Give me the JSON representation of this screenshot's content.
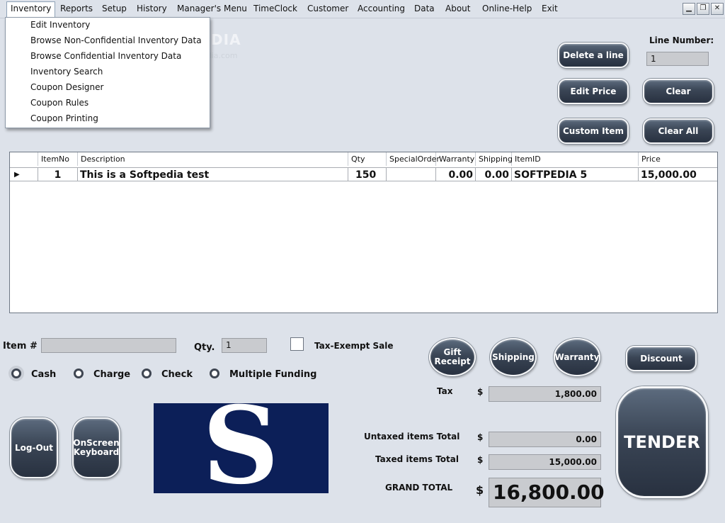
{
  "menu": {
    "items": [
      "Inventory",
      "Reports",
      "Setup",
      "History",
      "Manager's Menu",
      "TimeClock",
      "Customer",
      "Accounting",
      "Data",
      "About",
      "Online-Help",
      "Exit"
    ],
    "active": "Inventory",
    "dropdown": [
      "Edit Inventory",
      "Browse Non-Confidential Inventory Data",
      "Browse Confidential Inventory Data",
      "Inventory Search",
      "Coupon Designer",
      "Coupon Rules",
      "Coupon Printing"
    ]
  },
  "window_controls": {
    "minimize": "▁",
    "restore": "❐",
    "close": "✕"
  },
  "watermark": {
    "brand": "SOFTPEDIA",
    "url": "www.softpedia.com"
  },
  "line_number": {
    "label": "Line Number:",
    "value": "1"
  },
  "buttons": {
    "delete_line": "Delete a line",
    "edit_price": "Edit Price",
    "clear": "Clear",
    "custom_item": "Custom Item",
    "clear_all": "Clear All",
    "gift_receipt": "Gift Receipt",
    "shipping": "Shipping",
    "warranty": "Warranty",
    "discount": "Discount",
    "logout": "Log-Out",
    "onscreen_keyboard": "OnScreen Keyboard",
    "tender": "TENDER"
  },
  "grid": {
    "columns": [
      "ItemNo",
      "Description",
      "Qty",
      "SpecialOrder",
      "Warranty",
      "Shipping",
      "ItemID",
      "Price"
    ],
    "rows": [
      {
        "itemno": "1",
        "description": "This is a Softpedia test",
        "qty": "150",
        "special_order": "",
        "warranty": "0.00",
        "shipping": "0.00",
        "itemid": "SOFTPEDIA 5",
        "price": "15,000.00"
      }
    ]
  },
  "entry": {
    "item_label": "Item #",
    "item_value": "",
    "qty_label": "Qty.",
    "qty_value": "1",
    "tax_exempt_label": "Tax-Exempt Sale"
  },
  "payment": {
    "options": [
      "Cash",
      "Charge",
      "Check",
      "Multiple Funding"
    ],
    "selected": "Cash"
  },
  "logo": {
    "letter": "S"
  },
  "totals": {
    "currency": "$",
    "tax_label": "Tax",
    "tax": "1,800.00",
    "untaxed_label": "Untaxed items Total",
    "untaxed": "0.00",
    "taxed_label": "Taxed items Total",
    "taxed": "15,000.00",
    "grand_label": "GRAND TOTAL",
    "grand": "16,800.00"
  }
}
